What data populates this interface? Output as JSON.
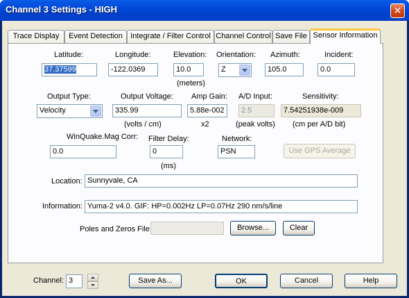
{
  "window": {
    "title": "Channel 3 Settings - HIGH",
    "close_glyph": "✕"
  },
  "tabs": [
    {
      "label": "Trace Display"
    },
    {
      "label": "Event Detection"
    },
    {
      "label": "Integrate / Filter Control"
    },
    {
      "label": "Channel Control"
    },
    {
      "label": "Save File"
    },
    {
      "label": "Sensor Information",
      "active": true
    }
  ],
  "sensor": {
    "latitude": {
      "label": "Latitude:",
      "value": "37.37599"
    },
    "longitude": {
      "label": "Longitude:",
      "value": "-122.0369"
    },
    "elevation": {
      "label": "Elevation:",
      "value": "10.0",
      "unit": "(meters)"
    },
    "orientation": {
      "label": "Orientation:",
      "value": "Z"
    },
    "azimuth": {
      "label": "Azimuth:",
      "value": "105.0"
    },
    "incident": {
      "label": "Incident:",
      "value": "0.0"
    },
    "output_type": {
      "label": "Output Type:",
      "value": "Velocity"
    },
    "output_voltage": {
      "label": "Output Voltage:",
      "value": "335.99",
      "unit": "(volts / cm)"
    },
    "amp_gain": {
      "label": "Amp Gain:",
      "value": "5.88e-002",
      "unit": "x2"
    },
    "ad_input": {
      "label": "A/D Input:",
      "value": "2.5",
      "unit": "(peak volts)"
    },
    "sensitivity": {
      "label": "Sensitivity:",
      "value": "7.54251938e-009",
      "unit": "(cm per A/D bit)"
    },
    "winquake_mag_corr": {
      "label": "WinQuake.Mag Corr:",
      "value": "0.0"
    },
    "filter_delay": {
      "label": "Filter Delay:",
      "value": "0",
      "unit": "(ms)"
    },
    "network": {
      "label": "Network:",
      "value": "PSN"
    },
    "use_gps_button": "Use GPS Average",
    "location": {
      "label": "Location:",
      "value": "Sunnyvale, CA"
    },
    "information": {
      "label": "Information:",
      "value": "Yuma-2 v4.0. GIF: HP=0.002Hz LP=0.07Hz 290 nm/s/line"
    },
    "poles_zeros": {
      "label": "Poles and Zeros File:",
      "value": "",
      "browse": "Browse...",
      "clear": "Clear"
    }
  },
  "footer": {
    "channel_label": "Channel:",
    "channel_value": "3",
    "save_as": "Save As...",
    "ok": "OK",
    "cancel": "Cancel",
    "help": "Help"
  }
}
